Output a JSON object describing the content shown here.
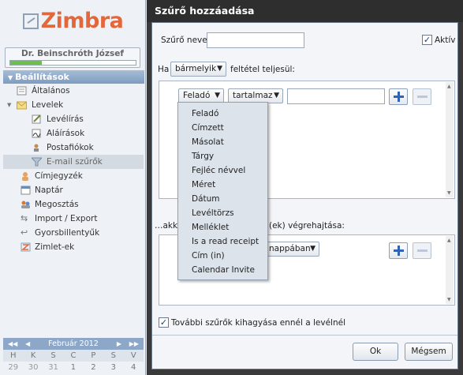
{
  "app": {
    "logo": "Zimbra"
  },
  "user": {
    "name": "Dr. Beinschróth József",
    "quota_fraction": 0.25
  },
  "sidebar": {
    "section": "Beállítások",
    "items": [
      {
        "label": "Általános",
        "icon": "general-settings-icon"
      },
      {
        "label": "Levelek",
        "icon": "mail-icon"
      },
      {
        "label": "Levélírás",
        "icon": "compose-icon"
      },
      {
        "label": "Aláírások",
        "icon": "signature-icon"
      },
      {
        "label": "Postafiókok",
        "icon": "accounts-icon"
      },
      {
        "label": "E-mail szűrők",
        "icon": "filter-icon"
      },
      {
        "label": "Címjegyzék",
        "icon": "contacts-icon"
      },
      {
        "label": "Naptár",
        "icon": "calendar-icon"
      },
      {
        "label": "Megosztás",
        "icon": "sharing-icon"
      },
      {
        "label": "Import / Export",
        "icon": "import-export-icon"
      },
      {
        "label": "Gyorsbillentyűk",
        "icon": "shortcuts-icon"
      },
      {
        "label": "Zimlet-ek",
        "icon": "zimlets-icon"
      }
    ]
  },
  "calendar": {
    "month": "Február 2012",
    "weekdays": [
      "H",
      "K",
      "S",
      "C",
      "P",
      "S",
      "V"
    ],
    "row": [
      "29",
      "30",
      "31",
      "1",
      "2",
      "3",
      "4"
    ]
  },
  "dialog": {
    "title": "Szűrő hozzáadása",
    "filter_name_label": "Szűrő neve:",
    "filter_name_value": "",
    "active_label": "Aktív",
    "active_checked": true,
    "if_label": "Ha",
    "match_select": "bármelyik",
    "condition_label": "feltétel teljesül:",
    "field_select": "Feladó",
    "operator_select": "tartalmaz",
    "condition_value": "",
    "actions_label": "…akk",
    "actions_label_tail": "(ek) végrehajtása:",
    "action_select_tail": "nappában",
    "skip_label": "További szűrők kihagyása ennél a levélnél",
    "skip_checked": true,
    "ok_label": "Ok",
    "cancel_label": "Mégsem"
  },
  "field_menu": [
    "Feladó",
    "Címzett",
    "Másolat",
    "Tárgy",
    "Fejléc névvel",
    "Méret",
    "Dátum",
    "Levéltörzs",
    "Melléklet",
    "Is a read receipt",
    "Cím (in)",
    "Calendar Invite"
  ]
}
